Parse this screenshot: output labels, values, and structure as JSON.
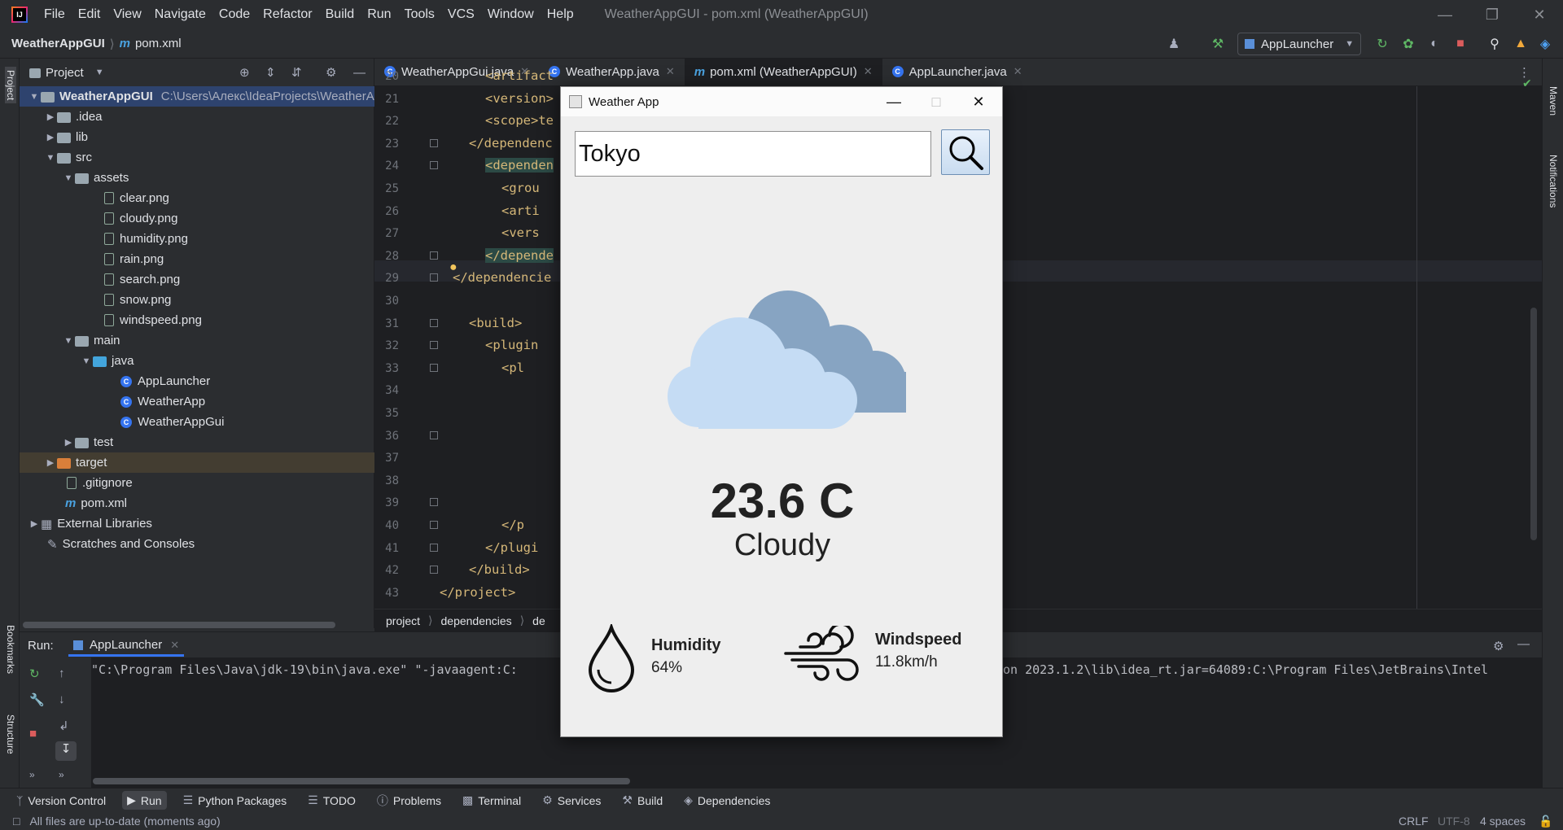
{
  "ide": {
    "menu": [
      "File",
      "Edit",
      "View",
      "Navigate",
      "Code",
      "Refactor",
      "Build",
      "Run",
      "Tools",
      "VCS",
      "Window",
      "Help"
    ],
    "window_title": "WeatherAppGUI - pom.xml (WeatherAppGUI)",
    "breadcrumb": {
      "project": "WeatherAppGUI",
      "file": "pom.xml"
    },
    "run_config": "AppLauncher"
  },
  "project_panel": {
    "title": "Project",
    "root_name": "WeatherAppGUI",
    "root_path": "C:\\Users\\Алекс\\IdeaProjects\\WeatherA",
    "items": [
      ".idea",
      "lib",
      "src",
      "assets",
      "clear.png",
      "cloudy.png",
      "humidity.png",
      "rain.png",
      "search.png",
      "snow.png",
      "windspeed.png",
      "main",
      "java",
      "AppLauncher",
      "WeatherApp",
      "WeatherAppGui",
      "test",
      "target",
      ".gitignore",
      "pom.xml",
      "External Libraries",
      "Scratches and Consoles"
    ]
  },
  "editor": {
    "tabs": [
      "WeatherAppGui.java",
      "WeatherApp.java",
      "pom.xml (WeatherAppGUI)",
      "AppLauncher.java"
    ],
    "active_tab": 2,
    "line_numbers": [
      "20",
      "21",
      "22",
      "23",
      "24",
      "25",
      "26",
      "27",
      "28",
      "29",
      "30",
      "31",
      "32",
      "33",
      "34",
      "35",
      "36",
      "37",
      "38",
      "39",
      "40",
      "41",
      "42",
      "43"
    ],
    "code": [
      "<artifact",
      "<version>",
      "<scope>te",
      "</dependenc",
      "<dependen",
      "<grou",
      "<arti",
      "<vers",
      "</depende",
      "</dependencie",
      "",
      "<build>",
      "<plugin",
      "<pl",
      "",
      "",
      "",
      "",
      "",
      "",
      "</p",
      "</plugi",
      "</build>",
      "</project>"
    ],
    "crumbs": [
      "project",
      "dependencies",
      "de"
    ]
  },
  "run_panel": {
    "label": "Run:",
    "tab": "AppLauncher",
    "console_left": "\"C:\\Program Files\\Java\\jdk-19\\bin\\java.exe\" \"-javaagent:C:",
    "console_right": "on 2023.1.2\\lib\\idea_rt.jar=64089:C:\\Program Files\\JetBrains\\Intel"
  },
  "tool_windows": [
    "Version Control",
    "Run",
    "Python Packages",
    "TODO",
    "Problems",
    "Terminal",
    "Services",
    "Build",
    "Dependencies"
  ],
  "side_labels": {
    "project": "Project",
    "bookmarks": "Bookmarks",
    "structure": "Structure",
    "maven": "Maven",
    "notifications": "Notifications"
  },
  "status": {
    "message": "All files are up-to-date (moments ago)",
    "line_sep": "CRLF",
    "encoding": "UTF-8",
    "indent": "4 spaces"
  },
  "weather_app": {
    "title": "Weather App",
    "search_value": "Tokyo",
    "temperature": "23.6 C",
    "condition": "Cloudy",
    "humidity_label": "Humidity",
    "humidity_value": "64%",
    "windspeed_label": "Windspeed",
    "windspeed_value": "11.8km/h"
  }
}
